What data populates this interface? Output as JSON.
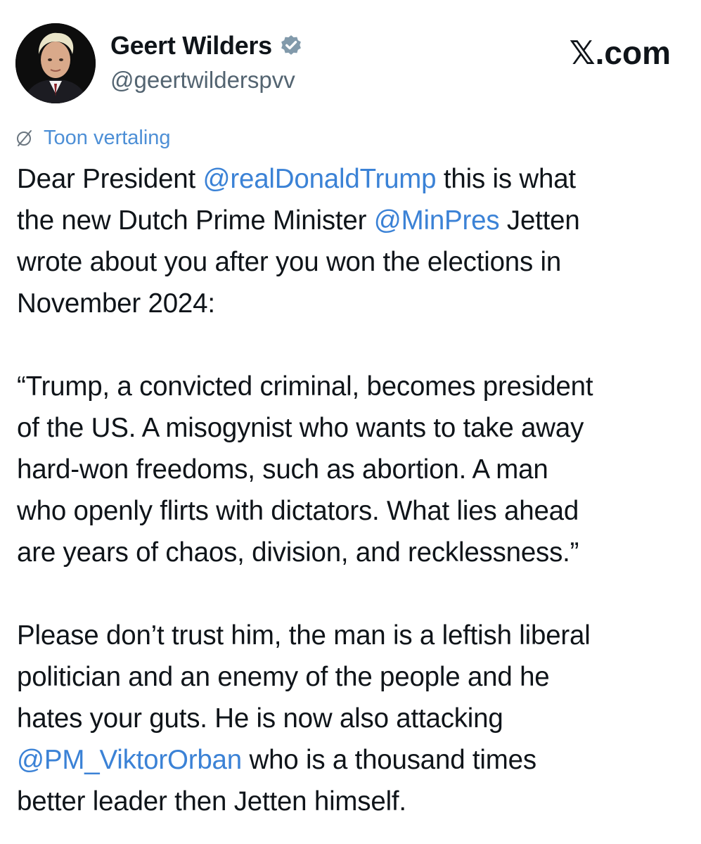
{
  "header": {
    "author_name": "Geert Wilders",
    "handle": "@geertwilderspvv",
    "brand": "𝕏.com",
    "verified_icon": "verified-badge-icon",
    "avatar_icon": "profile-avatar"
  },
  "translate": {
    "icon": "translate-globe-icon",
    "label": "Toon vertaling"
  },
  "tweet": {
    "p1": {
      "l1_a": "Dear President ",
      "l1_mention": "@realDonaldTrump",
      "l1_b": " this is what",
      "l2_a": "the new Dutch Prime Minister ",
      "l2_mention": "@MinPres",
      "l2_b": " Jetten",
      "l3": "wrote about you after you won the elections in",
      "l4": "November 2024:"
    },
    "p2": {
      "l1": "“Trump, a convicted criminal, becomes president",
      "l2": "of the US. A misogynist who wants to take away",
      "l3": "hard-won freedoms, such as abortion. A man",
      "l4": "who openly flirts with dictators. What lies ahead",
      "l5": "are years of chaos, division, and recklessness.”"
    },
    "p3": {
      "l1": "Please don’t trust him, the man is a leftish liberal",
      "l2": "politician and an enemy of the people and he",
      "l3": "hates your guts. He is now also attacking",
      "l4_mention": "@PM_ViktorOrban",
      "l4_b": " who is a thousand times",
      "l5": "better leader then Jetten himself."
    }
  },
  "colors": {
    "text": "#0f1419",
    "secondary": "#536471",
    "link": "#3b82d6",
    "verified": "#829aab"
  }
}
